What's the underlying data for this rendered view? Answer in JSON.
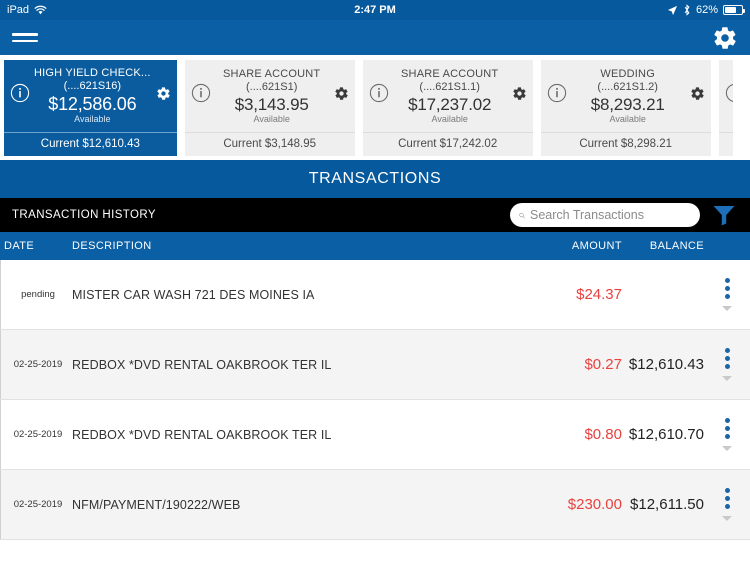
{
  "status_bar": {
    "device": "iPad",
    "wifi_icon": "wifi-icon",
    "time": "2:47 PM",
    "location_icon": "location-arrow-icon",
    "bluetooth_icon": "bluetooth-icon",
    "battery_percent": "62%",
    "battery_icon": "battery-icon"
  },
  "toolbar": {
    "menu_icon": "hamburger-menu-icon",
    "settings_icon": "gear-icon"
  },
  "accounts": [
    {
      "name": "HIGH YIELD CHECK...",
      "number": "(....621S16)",
      "available": "$12,586.06",
      "available_label": "Available",
      "current": "Current $12,610.43",
      "selected": true,
      "info_icon": "info-icon",
      "gear_icon": "gear-icon"
    },
    {
      "name": "SHARE ACCOUNT",
      "number": "(....621S1)",
      "available": "$3,143.95",
      "available_label": "Available",
      "current": "Current $3,148.95",
      "selected": false,
      "info_icon": "info-icon",
      "gear_icon": "gear-icon"
    },
    {
      "name": "SHARE ACCOUNT",
      "number": "(....621S1.1)",
      "available": "$17,237.02",
      "available_label": "Available",
      "current": "Current $17,242.02",
      "selected": false,
      "info_icon": "info-icon",
      "gear_icon": "gear-icon"
    },
    {
      "name": "WEDDING",
      "number": "(....621S1.2)",
      "available": "$8,293.21",
      "available_label": "Available",
      "current": "Current $8,298.21",
      "selected": false,
      "info_icon": "info-icon",
      "gear_icon": "gear-icon"
    }
  ],
  "transactions_banner": "TRANSACTIONS",
  "history": {
    "label": "TRANSACTION HISTORY",
    "search_placeholder": "Search Transactions",
    "search_value": "",
    "search_icon": "search-icon",
    "filter_icon": "funnel-filter-icon"
  },
  "columns": {
    "date": "DATE",
    "description": "DESCRIPTION",
    "amount": "AMOUNT",
    "balance": "BALANCE"
  },
  "rows": [
    {
      "date": "pending",
      "description": "MISTER CAR WASH 721 DES MOINES IA",
      "amount": "$24.37",
      "balance": ""
    },
    {
      "date": "02-25-2019",
      "description": "REDBOX *DVD RENTAL OAKBROOK TER IL",
      "amount": "$0.27",
      "balance": "$12,610.43"
    },
    {
      "date": "02-25-2019",
      "description": "REDBOX *DVD RENTAL OAKBROOK TER IL",
      "amount": "$0.80",
      "balance": "$12,610.70"
    },
    {
      "date": "02-25-2019",
      "description": "NFM/PAYMENT/190222/WEB",
      "amount": "$230.00",
      "balance": "$12,611.50"
    }
  ],
  "colors": {
    "primary_blue": "#05599C",
    "toolbar_blue": "#0A5FA5",
    "selected_card_blue": "#0B5C9E",
    "amount_red": "#E8423F",
    "dot_blue": "#1C64A8",
    "row_alt": "#F4F4F4",
    "black_bar": "#000000"
  }
}
